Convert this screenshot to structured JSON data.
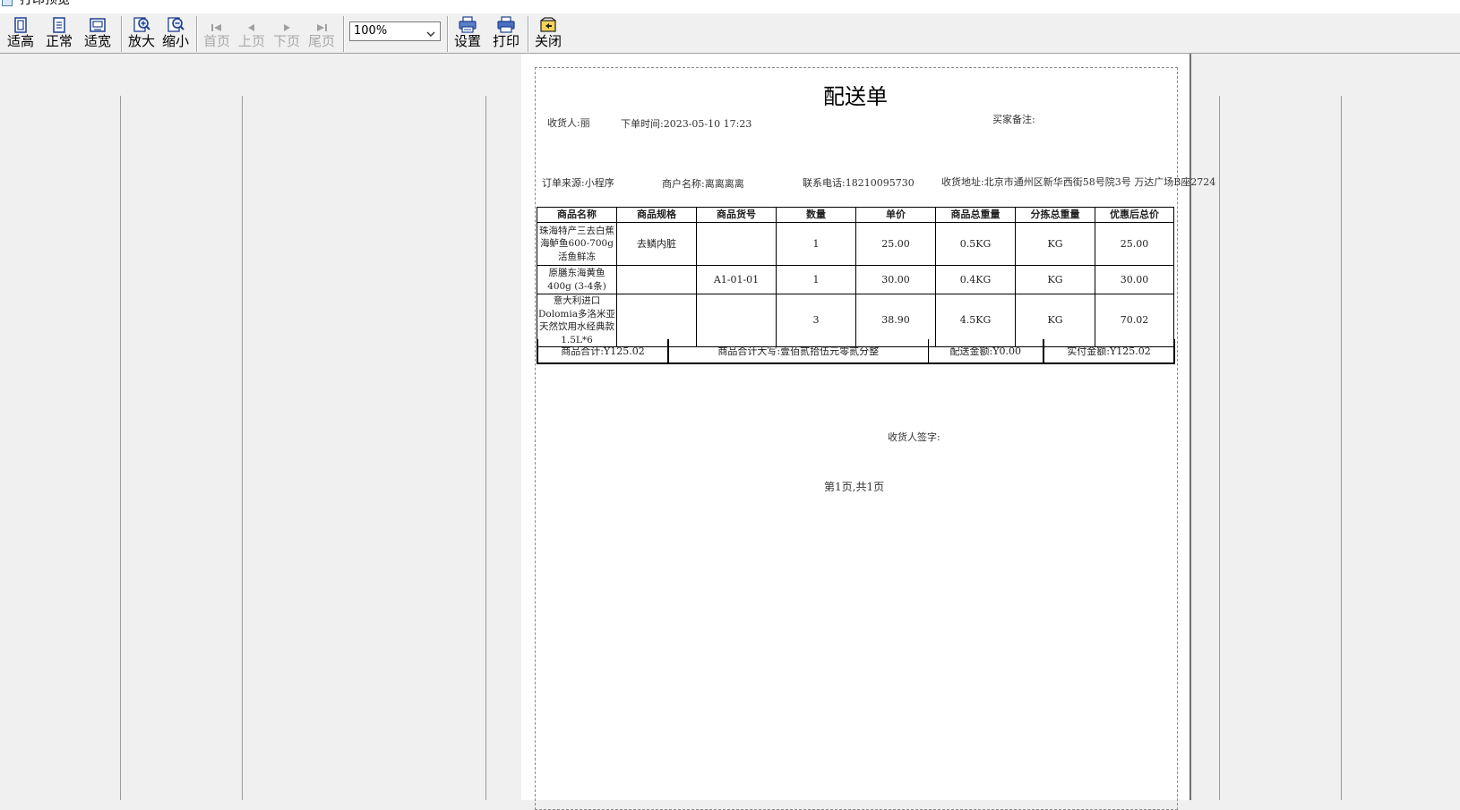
{
  "window": {
    "title": "打印预览"
  },
  "toolbar": {
    "buttons": [
      {
        "label": "适高",
        "icon": "fit-height-icon"
      },
      {
        "label": "正常",
        "icon": "normal-size-icon"
      },
      {
        "label": "适宽",
        "icon": "fit-width-icon"
      },
      {
        "label": "放大",
        "icon": "zoom-in-icon"
      },
      {
        "label": "缩小",
        "icon": "zoom-out-icon"
      },
      {
        "label": "首页",
        "icon": "first-page-icon"
      },
      {
        "label": "上页",
        "icon": "prev-page-icon"
      },
      {
        "label": "下页",
        "icon": "next-page-icon"
      },
      {
        "label": "尾页",
        "icon": "last-page-icon"
      },
      {
        "label": "设置",
        "icon": "settings-icon"
      },
      {
        "label": "打印",
        "icon": "printer-icon"
      },
      {
        "label": "关闭",
        "icon": "close-icon"
      }
    ],
    "zoom": "100%"
  },
  "document": {
    "title": "配送单",
    "receiver": "收货人:丽",
    "order_time": "下单时间:2023-05-10 17:23",
    "buyer_note": "买家备注:",
    "order_source": "订单来源:小程序",
    "merchant": "商户名称:离离离离",
    "phone": "联系电话:18210095730",
    "address": "收货地址:北京市通州区新华西街58号院3号 万达广场B座2724",
    "columns": [
      "商品名称",
      "商品规格",
      "商品货号",
      "数量",
      "单价",
      "商品总重量",
      "分拣总重量",
      "优惠后总价"
    ],
    "rows": [
      [
        "珠海特产三去白蕉海鲈鱼600-700g 活鱼鲜冻",
        "去鳞内脏",
        "",
        "1",
        "25.00",
        "0.5KG",
        "KG",
        "25.00"
      ],
      [
        "原膳东海黄鱼400g (3-4条)",
        "",
        "A1-01-01",
        "1",
        "30.00",
        "0.4KG",
        "KG",
        "30.00"
      ],
      [
        "意大利进口Dolomia多洛米亚天然饮用水经典款1.5L*6",
        "",
        "",
        "3",
        "38.90",
        "4.5KG",
        "KG",
        "70.02"
      ]
    ],
    "summary": {
      "subtotal": "商品合计:Y125.02",
      "subtotal_upper": "商品合计大写:壹佰贰拾伍元零贰分整",
      "delivery_fee": "配送金额:Y0.00",
      "paid": "实付金额:Y125.02"
    },
    "signature": "收货人签字:",
    "page_info": "第1页,共1页"
  }
}
